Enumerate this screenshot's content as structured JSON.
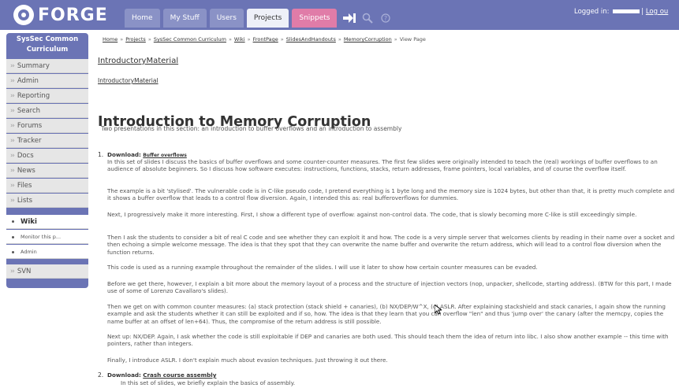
{
  "header": {
    "logo": "FORGE",
    "tabs": [
      "Home",
      "My Stuff",
      "Users",
      "Projects",
      "Snippets"
    ],
    "login_label": "Logged in:",
    "logout_label": "Log ou"
  },
  "sidebar": {
    "title": "SysSec Common Curriculum",
    "items": [
      {
        "label": "Summary"
      },
      {
        "label": "Admin"
      },
      {
        "label": "Reporting"
      },
      {
        "label": "Search"
      },
      {
        "label": "Forums"
      },
      {
        "label": "Tracker"
      },
      {
        "label": "Docs"
      },
      {
        "label": "News"
      },
      {
        "label": "Files"
      },
      {
        "label": "Lists"
      },
      {
        "label": "Wiki"
      },
      {
        "label": "Monitor this p..."
      },
      {
        "label": "Admin"
      },
      {
        "label": "SVN"
      }
    ]
  },
  "breadcrumb": {
    "items": [
      "Home",
      "Projects",
      "SysSec Common Curriculum",
      "Wiki",
      "FrontPage",
      "SlidesAndHandouts",
      "MemoryCorruption"
    ],
    "current": "View Page"
  },
  "page": {
    "title": "IntroductoryMaterial",
    "link": "IntroductoryMaterial",
    "heading": "Introduction to Memory Corruption",
    "intro": "Two presentations in this section: an introduction to buffer overflows and an introduction to assembly",
    "item1_num": "1.",
    "item1_label": "Download:",
    "item1_link": "Buffer overflows",
    "p1": "In this set of slides I discuss the basics of buffer overflows and some counter-counter measures. The first few slides were originally intended to teach the (real) workings of buffer overflows to an audience of absolute beginners. So I discuss how software executes: instructions, functions, stacks, return addresses, frame pointers, local variables, and of course the overflow itself.",
    "p2": "The example is a bit 'stylised'. The vulnerable code is in C-like pseudo code, I pretend everything is 1 byte long and the memory size is 1024 bytes, but other than that, it is pretty much complete and it shows a buffer overflow that leads to a control flow diversion. Again, I intended this as: real bufferoverflows for dummies.",
    "p3": "Next, I progressively make it more interesting. First, I show a different type of overflow: against non-control data. The code, that is slowly becoming more C-like is still exceedingly simple.",
    "p4": "Then I ask the students to consider a bit of real C code and see whether they can exploit it and how. The code is a very simple server that welcomes clients by reading in their name over a socket and then echoing a simple welcome message. The idea is that they spot that they can overwrite the name buffer and overwrite the return address, which will lead to a control flow diversion when the function returns.",
    "p5": "This code is used as a running example throughout the remainder of the slides. I will use it later to show how certain counter measures can be evaded.",
    "p6": "Before we get there, however, I explain a bit more about the memory layout of a process and the structure of injection vectors (nop, unpacker, shellcode, starting address). (BTW for this part, I made use of some of Lorenzo Cavallaro's slides).",
    "p7": "Then we get on with common counter measures: (a) stack protection (stack shield + canaries), (b) NX/DEP/W^X, (c) ASLR. After explaining stackshield and stack canaries, I again show the running example and ask the students whether it can still be exploited and if so, how. The idea is that they learn that you can overflow \"len\" and thus 'jump over' the canary (after the memcpy, copies the name buffer at an offset of len+64). Thus, the compromise of the return address is still possible.",
    "p8": "Next up: NX/DEP. Again, I ask whether the code is still exploitable if DEP and canaries are both used. This should teach them the idea of return into libc. I also show another example -- this time with pointers, rather than integers.",
    "p9": "Finally, I introduce ASLR. I don't explain much about evasion techniques. Just throwing it out there.",
    "item2_num": "2.",
    "item2_label": "Download:",
    "item2_link": "Crash course assembly",
    "p10": "In this set of slides, we briefly explain the basics of assembly."
  },
  "colors": {
    "header_bg": "#6b74b5",
    "snippets_tab": "#e07ca8",
    "sidebar_item_bg": "#e6e6e6"
  }
}
